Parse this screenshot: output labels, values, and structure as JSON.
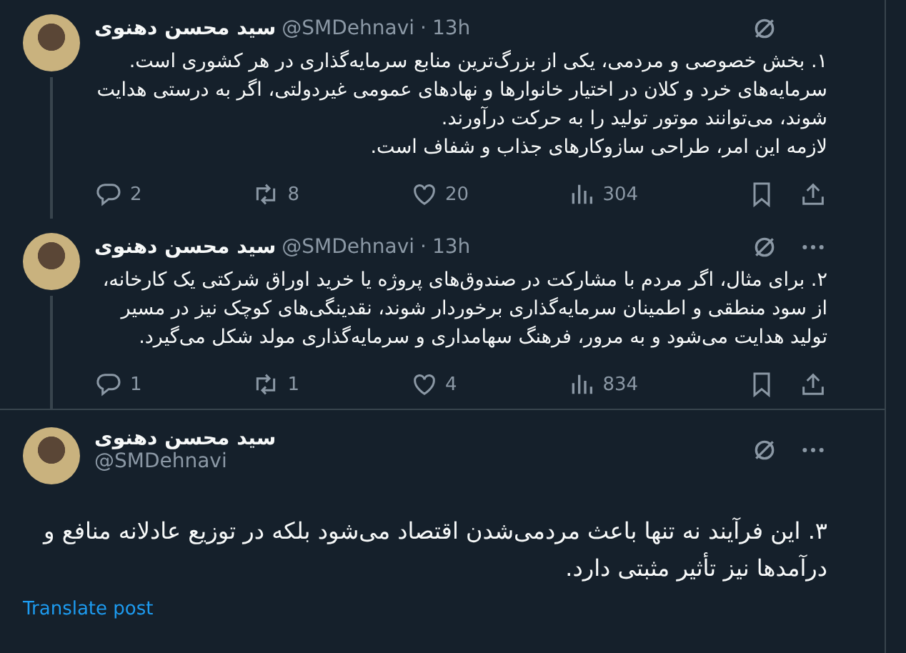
{
  "tweets": [
    {
      "kind": "thread",
      "author": "سید محسن دهنوی",
      "handle": "@SMDehnavi",
      "dot": "·",
      "time": "13h",
      "show_menu": false,
      "text": "۱. بخش خصوصی و مردمی، یکی از بزرگ‌ترین منابع سرمایه‌گذاری در هر کشوری است.\nسرمایه‌های خرد و کلان در اختیار خانوارها و نهادهای عمومی غیردولتی، اگر به درستی هدایت شوند، می‌توانند موتور تولید را به حرکت درآورند.\nلازمه این امر، طراحی سازوکارهای جذاب و شفاف است.",
      "stats": {
        "replies": "2",
        "reposts": "8",
        "likes": "20",
        "views": "304"
      }
    },
    {
      "kind": "thread",
      "author": "سید محسن دهنوی",
      "handle": "@SMDehnavi",
      "dot": "·",
      "time": "13h",
      "show_menu": true,
      "text": "۲. برای مثال، اگر مردم با مشارکت در صندوق‌های پروژه یا خرید اوراق شرکتی یک کارخانه، از سود منطقی و اطمینان سرمایه‌گذاری برخوردار شوند، نقدینگی‌های کوچک نیز در مسیر تولید هدایت می‌شود و به مرور، فرهنگ سهامداری و سرمایه‌گذاری مولد شکل می‌گیرد.",
      "stats": {
        "replies": "1",
        "reposts": "1",
        "likes": "4",
        "views": "834"
      }
    },
    {
      "kind": "focused",
      "author": "سید محسن دهنوی",
      "handle": "@SMDehnavi",
      "show_menu": true,
      "text": "۳. این فرآیند نه تنها باعث مردمی‌شدن اقتصاد می‌شود بلکه در توزیع عادلانه منافع و درآمدها نیز تأثیر مثبتی دارد.",
      "translate": "Translate post"
    }
  ]
}
